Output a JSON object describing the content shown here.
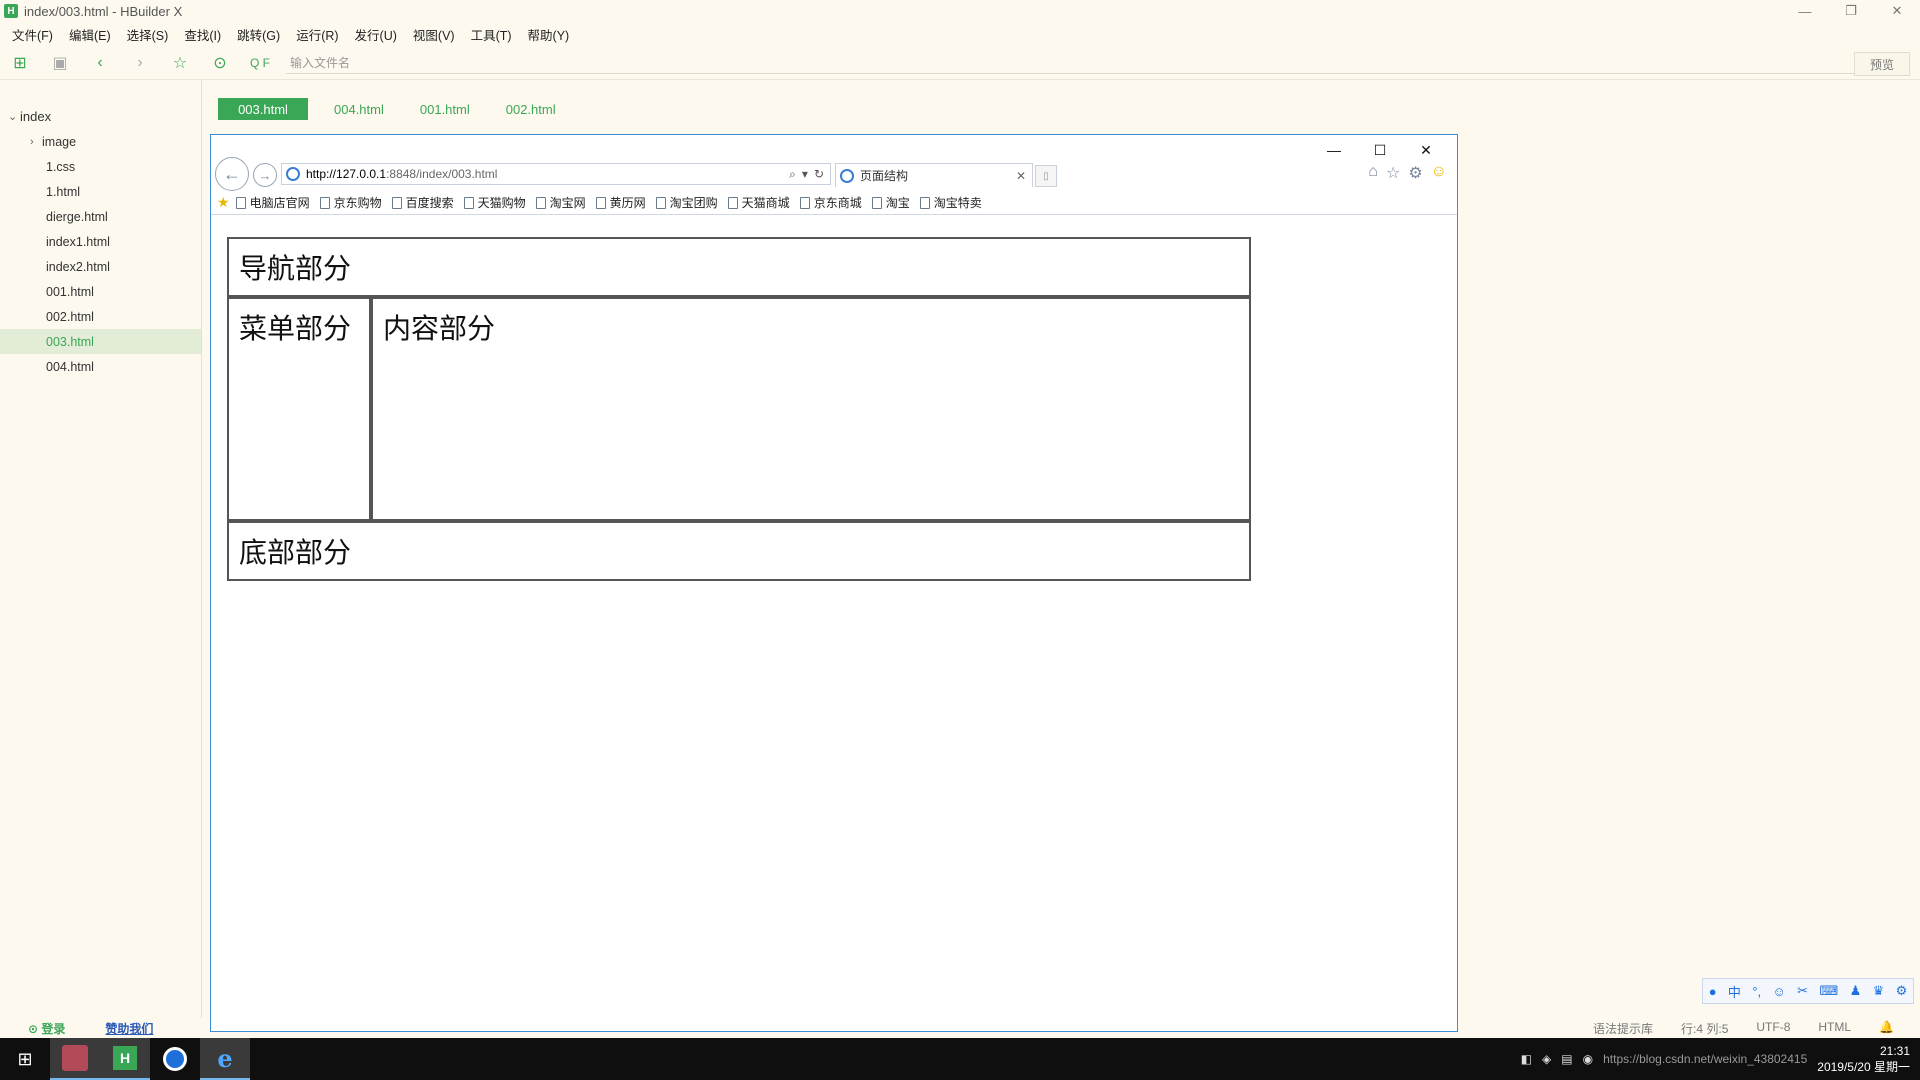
{
  "window": {
    "title": "index/003.html - HBuilder X",
    "app_icon": "H"
  },
  "menu": [
    "文件(F)",
    "编辑(E)",
    "选择(S)",
    "查找(I)",
    "跳转(G)",
    "运行(R)",
    "发行(U)",
    "视图(V)",
    "工具(T)",
    "帮助(Y)"
  ],
  "toolbar": {
    "file_search_placeholder": "输入文件名",
    "search_label": "Q F",
    "preview_label": "预览"
  },
  "sidebar": {
    "root": "index",
    "folder": "image",
    "files": [
      "1.css",
      "1.html",
      "dierge.html",
      "index1.html",
      "index2.html",
      "001.html",
      "002.html",
      "003.html",
      "004.html"
    ],
    "active_file": "003.html"
  },
  "tabs": [
    "003.html",
    "004.html",
    "001.html",
    "002.html"
  ],
  "browser": {
    "url_host": "http://127.0.0.1",
    "url_rest": ":8848/index/003.html",
    "tab_title": "页面结构",
    "favorites": [
      "电脑店官网",
      "京东购物",
      "百度搜索",
      "天猫购物",
      "淘宝网",
      "黄历网",
      "淘宝团购",
      "天猫商城",
      "京东商城",
      "淘宝",
      "淘宝特卖"
    ]
  },
  "page": {
    "nav": "导航部分",
    "menu": "菜单部分",
    "content": "内容部分",
    "footer": "底部部分"
  },
  "status": {
    "login": "登录",
    "sponsor": "赞助我们",
    "hint": "语法提示库",
    "position": "行:4  列:5",
    "encoding": "UTF-8",
    "language": "HTML"
  },
  "taskbar": {
    "time": "21:31",
    "date": "2019/5/20 星期一",
    "watermark": "https://blog.csdn.net/weixin_43802415"
  },
  "ime": {
    "lang": "中"
  },
  "colors": {
    "accent": "#3aa757",
    "browser_border": "#3b8fd9",
    "background": "#fdf9ee"
  }
}
